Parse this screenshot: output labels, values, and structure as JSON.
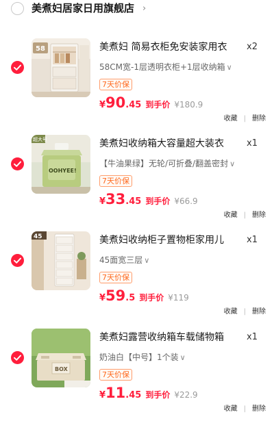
{
  "store": {
    "name": "美煮妇居家日用旗舰店",
    "chevron": "›"
  },
  "items": [
    {
      "title": "美煮妇 简易衣柜免安装家用衣",
      "qty": "x2",
      "spec": "58CM宽-1层透明衣柜+1层收纳箱",
      "spec_caret": "∨",
      "badge": "7天价保",
      "currency": "¥",
      "price_int": "90",
      "price_dec": ".45",
      "deal_label": "到手价",
      "orig_price": "¥180.9",
      "fav_label": "收藏",
      "delete_label": "删除",
      "image_text": "58"
    },
    {
      "title": "美煮妇收纳箱大容量超大装衣",
      "qty": "x1",
      "spec": "【牛油果绿】无轮/可折叠/翻盖密封",
      "spec_caret": "∨",
      "badge": "7天价保",
      "currency": "¥",
      "price_int": "33",
      "price_dec": ".45",
      "deal_label": "到手价",
      "orig_price": "¥66.9",
      "fav_label": "收藏",
      "delete_label": "删除",
      "image_text": "OOHYEE!",
      "image_tag": "超大号"
    },
    {
      "title": "美煮妇收纳柜子置物柜家用儿",
      "qty": "x1",
      "spec": "45面宽三层",
      "spec_caret": "∨",
      "badge": "7天价保",
      "currency": "¥",
      "price_int": "59",
      "price_dec": ".5",
      "deal_label": "到手价",
      "orig_price": "¥119",
      "fav_label": "收藏",
      "delete_label": "删除",
      "image_text": "45"
    },
    {
      "title": "美煮妇露营收纳箱车载储物箱",
      "qty": "x1",
      "spec": "奶油白【中号】1个装",
      "spec_caret": "∨",
      "badge": "7天价保",
      "currency": "¥",
      "price_int": "11",
      "price_dec": ".45",
      "deal_label": "到手价",
      "orig_price": "¥22.9",
      "fav_label": "收藏",
      "delete_label": "删除",
      "image_text": "BOX"
    }
  ],
  "colors": {
    "accent": "#ff1e3c",
    "badge": "#ff6a1f",
    "muted": "#9a9a9a"
  }
}
